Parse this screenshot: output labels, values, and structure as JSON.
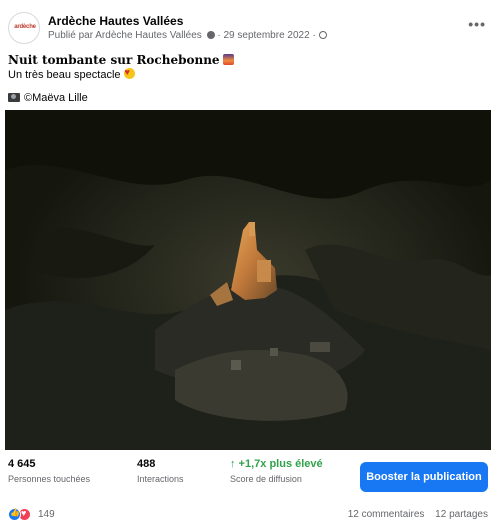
{
  "header": {
    "page_name": "Ardèche Hautes Vallées",
    "avatar_text": "ardèche",
    "meta": "Publié par Ardèche Hautes Vallées",
    "date": "29 septembre 2022",
    "more_icon": "more-options-icon"
  },
  "post": {
    "title": "Nuit tombante sur Rochebonne",
    "subtitle": "Un très beau spectacle",
    "credit": "©Maëva Lille"
  },
  "stats": {
    "reach_value": "4 645",
    "reach_label": "Personnes touchées",
    "interactions_value": "488",
    "interactions_label": "Interactions",
    "score_value": "↑ +1,7x plus élevé",
    "score_label": "Score de diffusion",
    "boost_label": "Booster la publication"
  },
  "footer": {
    "reactions_count": "149",
    "comments": "12 commentaires",
    "shares": "12 partages"
  },
  "colors": {
    "accent": "#1877f2",
    "muted_text": "#65676b",
    "score_green": "#31a24c",
    "love": "#f33e58"
  }
}
